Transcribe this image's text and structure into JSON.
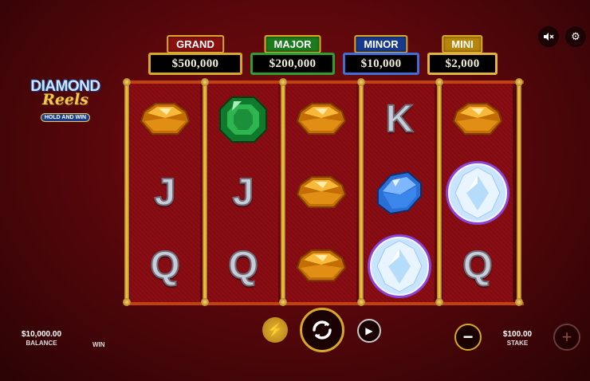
{
  "logo": {
    "title": "DIAMOND",
    "subtitle": "Reels",
    "tag": "HOLD AND WIN"
  },
  "jackpots": [
    {
      "label": "GRAND",
      "value": "$500,000",
      "color": "#8a1010"
    },
    {
      "label": "MAJOR",
      "value": "$200,000",
      "color": "#1d7a1d"
    },
    {
      "label": "MINOR",
      "value": "$10,000",
      "color": "#173a8f"
    },
    {
      "label": "MINI",
      "value": "$2,000",
      "color": "#b8860b"
    }
  ],
  "reels": [
    [
      "amber-gem",
      "J",
      "Q"
    ],
    [
      "emerald-gem",
      "J",
      "Q"
    ],
    [
      "amber-gem",
      "amber-gem",
      "amber-gem"
    ],
    [
      "K",
      "blue-diamond",
      "white-diamond"
    ],
    [
      "amber-gem",
      "white-diamond",
      "Q"
    ]
  ],
  "controls": {
    "balance_value": "$10,000.00",
    "balance_label": "BALANCE",
    "win_label": "WIN",
    "stake_value": "$100.00",
    "stake_label": "STAKE",
    "minus_symbol": "−",
    "plus_symbol": "+"
  },
  "icons": {
    "sound": "mute-icon",
    "settings": "gear-icon",
    "turbo": "lightning-icon",
    "spin": "spin-arrows-icon",
    "autoplay": "play-icon"
  }
}
